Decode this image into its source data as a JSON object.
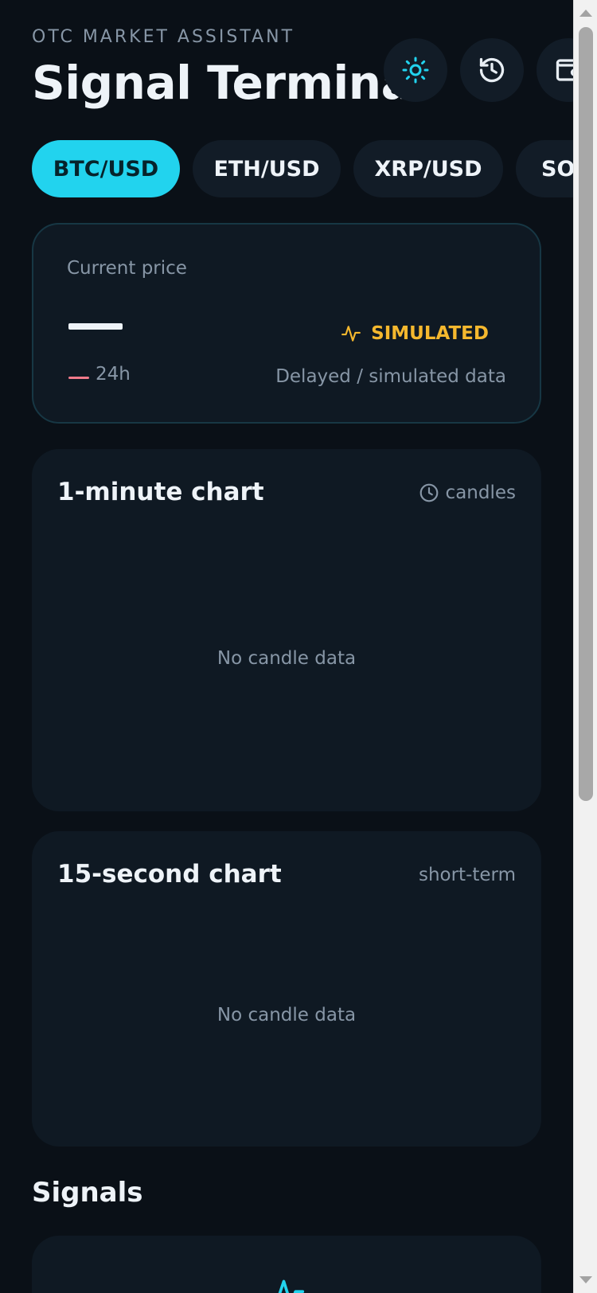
{
  "header": {
    "eyebrow": "OTC MARKET ASSISTANT",
    "title": "Signal Terminal",
    "actions": [
      {
        "icon": "sun-icon",
        "color": "#22d3ee"
      },
      {
        "icon": "history-icon",
        "color": "#e8eef4"
      },
      {
        "icon": "wallet-icon",
        "color": "#e8eef4"
      }
    ]
  },
  "pairs": {
    "items": [
      "BTC/USD",
      "ETH/USD",
      "XRP/USD",
      "SOL/USD"
    ],
    "active": "BTC/USD"
  },
  "price_card": {
    "label": "Current price",
    "price_value": "—",
    "change_value": "—",
    "change_period": "24h",
    "change_color": "#f07a8a",
    "status_icon": "activity-icon",
    "status": "SIMULATED",
    "status_color": "#f5b82e",
    "note": "Delayed / simulated data"
  },
  "charts": [
    {
      "title": "1-minute chart",
      "meta_icon": "clock-icon",
      "meta": "candles",
      "empty": "No candle data"
    },
    {
      "title": "15-second chart",
      "meta": "short-term",
      "empty": "No candle data"
    }
  ],
  "signals": {
    "title": "Signals",
    "icon": "activity-icon",
    "icon_color": "#22d3ee"
  },
  "colors": {
    "background": "#0a1017",
    "card": "#0f1923",
    "accent": "#22d3ee",
    "warning": "#f5b82e",
    "muted": "#8796a6"
  }
}
